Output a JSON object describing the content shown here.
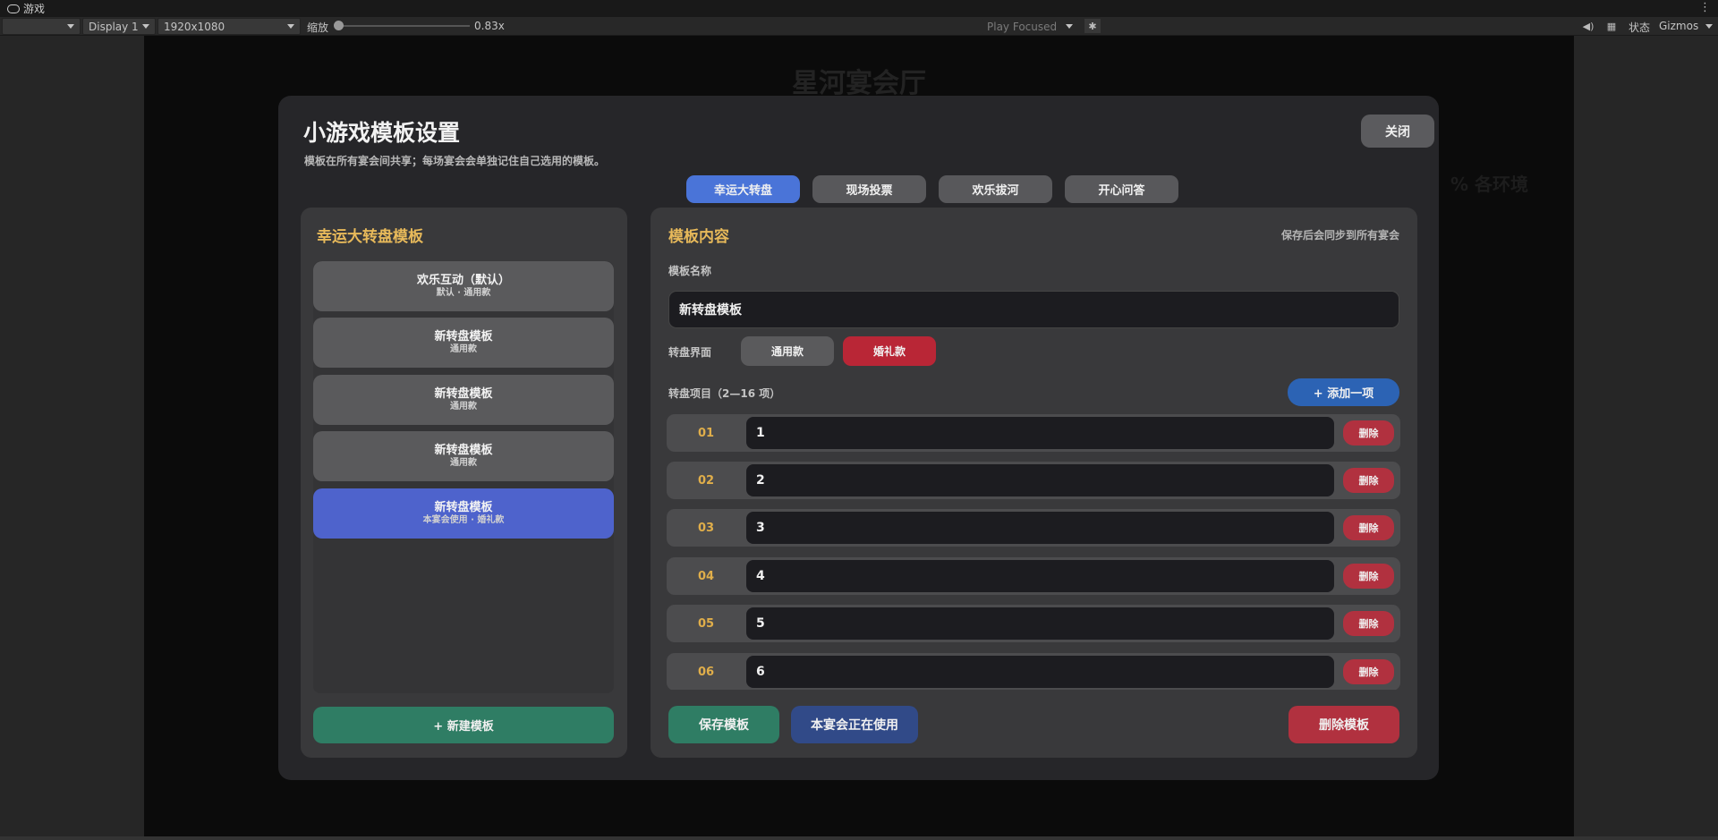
{
  "editor": {
    "tab_label": "游戏",
    "toolbar": {
      "display": "Display 1",
      "resolution": "1920x1080",
      "scale_label": "缩放",
      "scale_value": "0.83x",
      "play_mode": "Play Focused",
      "stats_label": "状态",
      "gizmos_label": "Gizmos"
    }
  },
  "background": {
    "hall_title": "星河宴会厅",
    "side_text": "% 各环境"
  },
  "modal": {
    "title": "小游戏模板设置",
    "subtitle": "模板在所有宴会间共享；每场宴会会单独记住自己选用的模板。",
    "close_label": "关闭",
    "tabs": [
      {
        "label": "幸运大转盘",
        "active": true
      },
      {
        "label": "现场投票",
        "active": false
      },
      {
        "label": "欢乐拔河",
        "active": false
      },
      {
        "label": "开心问答",
        "active": false
      }
    ],
    "left_panel": {
      "title": "幸运大转盘模板",
      "templates": [
        {
          "name": "欢乐互动（默认）",
          "meta": "默认 · 通用款",
          "active": false
        },
        {
          "name": "新转盘模板",
          "meta": "通用款",
          "active": false
        },
        {
          "name": "新转盘模板",
          "meta": "通用款",
          "active": false
        },
        {
          "name": "新转盘模板",
          "meta": "通用款",
          "active": false
        },
        {
          "name": "新转盘模板",
          "meta": "本宴会使用 · 婚礼款",
          "active": true
        }
      ],
      "new_button": "+ 新建模板"
    },
    "right_panel": {
      "title": "模板内容",
      "note": "保存后会同步到所有宴会",
      "name_label": "模板名称",
      "name_value": "新转盘模板",
      "style_label": "转盘界面",
      "styles": [
        {
          "label": "通用款",
          "selected": false,
          "color": "#5a5a5c"
        },
        {
          "label": "婚礼款",
          "selected": true,
          "color": "#b92636"
        }
      ],
      "items_label": "转盘项目（2—16 项）",
      "add_button": "+ 添加一项",
      "delete_item_label": "删除",
      "items": [
        {
          "no": "01",
          "value": "1"
        },
        {
          "no": "02",
          "value": "2"
        },
        {
          "no": "03",
          "value": "3"
        },
        {
          "no": "04",
          "value": "4"
        },
        {
          "no": "05",
          "value": "5"
        },
        {
          "no": "06",
          "value": "6"
        }
      ],
      "save_button": "保存模板",
      "in_use_button": "本宴会正在使用",
      "delete_button": "删除模板"
    }
  }
}
